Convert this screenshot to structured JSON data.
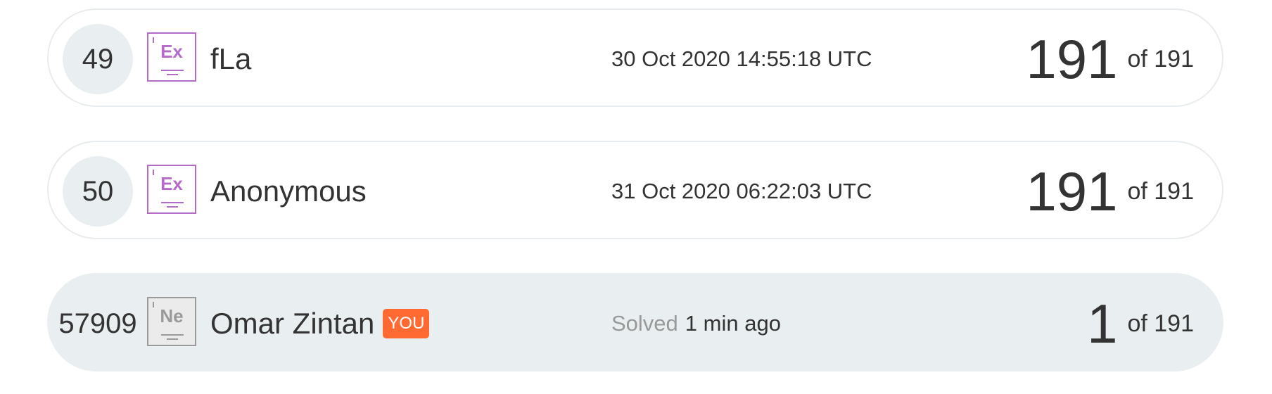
{
  "leaderboard": {
    "rows": [
      {
        "rank": "49",
        "badge": "Ex",
        "name": "fLa",
        "time": "30 Oct 2020 14:55:18 UTC",
        "solved": "191",
        "total_label": "of 191"
      },
      {
        "rank": "50",
        "badge": "Ex",
        "name": "Anonymous",
        "time": "31 Oct 2020 06:22:03 UTC",
        "solved": "191",
        "total_label": "of 191"
      },
      {
        "rank": "57909",
        "badge": "Ne",
        "name": "Omar Zintan",
        "you_tag": "YOU",
        "time_prefix": "Solved",
        "time": "1 min ago",
        "solved": "1",
        "total_label": "of 191"
      }
    ]
  },
  "colors": {
    "expert_badge": "#b56cc9",
    "neutral_badge": "#9a9a9a",
    "you_tag": "#ff6a33",
    "highlight_row": "#e9eef0"
  }
}
